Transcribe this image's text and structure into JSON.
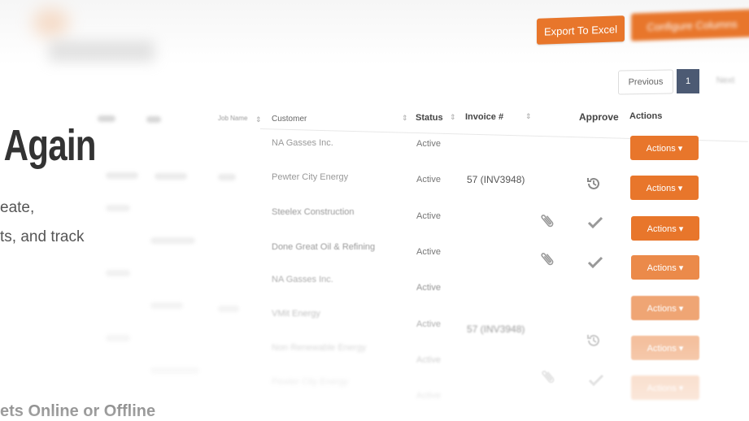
{
  "hero": {
    "headline": "t Again",
    "para_line1": "eate,",
    "para_line2": "ts, and track",
    "feature_text": "ets Online or Offline"
  },
  "toolbar": {
    "export_label": "Export To Excel",
    "configure_label": "Configure Columns"
  },
  "pagination": {
    "previous_label": "Previous",
    "current_page": "1",
    "next_label": "Next"
  },
  "table": {
    "headers": {
      "job_name": "Job Name",
      "customer": "Customer",
      "status": "Status",
      "invoice": "Invoice #",
      "approve": "Approve",
      "actions": "Actions"
    },
    "rows": [
      {
        "customer": "NA Gasses Inc.",
        "status": "Active",
        "invoice": "",
        "attach": false,
        "approve": "none",
        "action": "Actions ▾"
      },
      {
        "customer": "Pewter City Energy",
        "status": "Active",
        "invoice": "57 (INV3948)",
        "attach": false,
        "approve": "history",
        "action": "Actions ▾"
      },
      {
        "customer": "Steelex Construction",
        "status": "Active",
        "invoice": "",
        "attach": true,
        "approve": "check",
        "action": "Actions ▾"
      },
      {
        "customer": "Done Great Oil & Refining",
        "status": "Active",
        "invoice": "",
        "attach": true,
        "approve": "check",
        "action": "Actions ▾"
      },
      {
        "customer": "NA Gasses Inc.",
        "status": "Active",
        "invoice": "",
        "attach": false,
        "approve": "none",
        "action": "Actions ▾"
      },
      {
        "customer": "VMit Energy",
        "status": "Active",
        "invoice": "57 (INV3948)",
        "attach": false,
        "approve": "none",
        "action": "Actions ▾"
      },
      {
        "customer": "Non Renewable Energy",
        "status": "Active",
        "invoice": "",
        "attach": false,
        "approve": "history",
        "action": "Actions ▾"
      },
      {
        "customer": "Pewter City Energy",
        "status": "Active",
        "invoice": "",
        "attach": true,
        "approve": "check",
        "action": "Actions ▾"
      }
    ]
  },
  "colors": {
    "accent": "#e8762b",
    "pager_active": "#4c5a73",
    "headline": "#333333"
  },
  "icons": {
    "attach": "paperclip-icon",
    "approved": "checkmark-icon",
    "history": "history-icon",
    "sort": "sort-icon"
  }
}
